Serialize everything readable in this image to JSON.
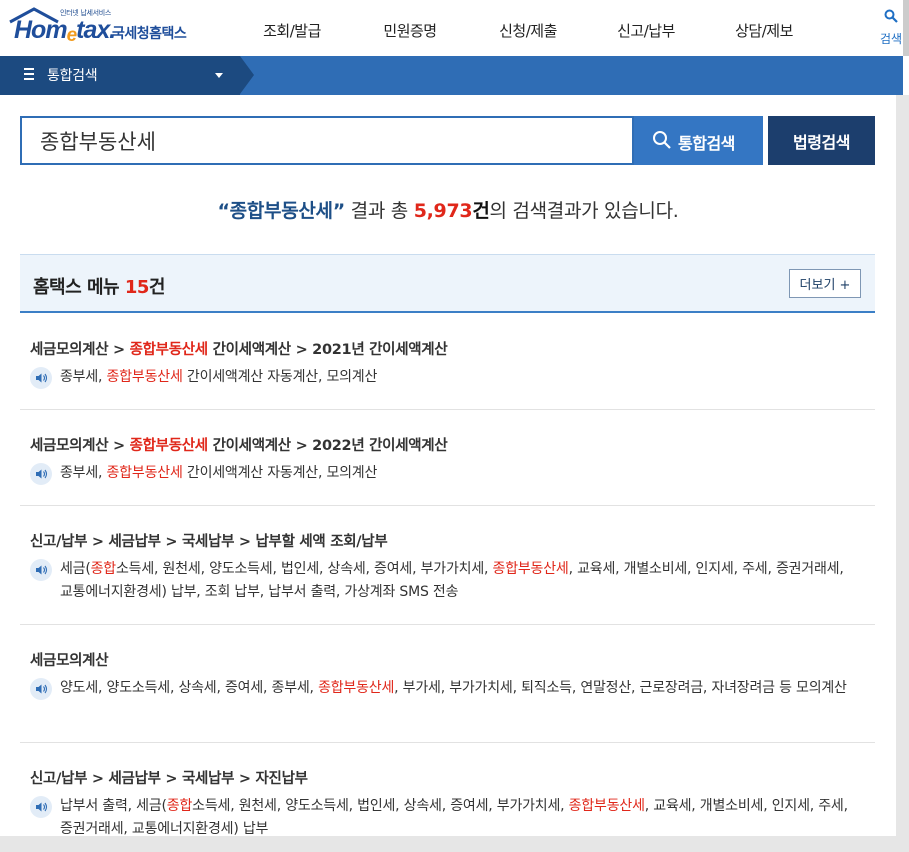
{
  "header": {
    "logo_tagline": "인터넷 납세서비스",
    "logo_home": "Hom",
    "logo_e": "e",
    "logo_tax": "tax.",
    "logo_kr": "국세청홈택스",
    "nav": [
      "조회/발급",
      "민원증명",
      "신청/제출",
      "신고/납부",
      "상담/제보"
    ],
    "search_label": "검색"
  },
  "breadcrumb": {
    "label": "통합검색"
  },
  "search": {
    "value": "종합부동산세",
    "integrated_button": "통합검색",
    "law_button": "법령검색"
  },
  "summary": {
    "quote_open": "“",
    "keyword": "종합부동산세",
    "quote_close": "”",
    "text1": " 결과 총 ",
    "count": "5,973",
    "unit": "건",
    "text2": "의 검색결과가 있습니다."
  },
  "section": {
    "title": "홈택스 메뉴 ",
    "count": "15",
    "unit": "건",
    "more_button": "더보기 +"
  },
  "results": [
    {
      "title_pre": "세금모의계산 > ",
      "title_hl": "종합부동산세",
      "title_post": " 간이세액계산 > 2021년 간이세액계산",
      "desc_pre": "종부세, ",
      "desc_hl": "종합부동산세",
      "desc_post": " 간이세액계산 자동계산, 모의계산"
    },
    {
      "title_pre": "세금모의계산 > ",
      "title_hl": "종합부동산세",
      "title_post": " 간이세액계산 > 2022년 간이세액계산",
      "desc_pre": "종부세, ",
      "desc_hl": "종합부동산세",
      "desc_post": " 간이세액계산 자동계산, 모의계산"
    },
    {
      "title_pre": "신고/납부 > 세금납부 > 국세납부 > 납부할 세액 조회/납부",
      "title_hl": "",
      "title_post": "",
      "desc_a": "세금(",
      "desc_hl1": "종합",
      "desc_b": "소득세, 원천세, 양도소득세, 법인세, 상속세, 증여세, 부가가치세, ",
      "desc_hl2": "종합부동산세",
      "desc_c": ", 교육세, 개별소비세, 인지세, 주세, 증권거래세, 교통에너지환경세) 납부, 조회 납부, 납부서 출력, 가상계좌 SMS 전송"
    },
    {
      "title_pre": "세금모의계산",
      "title_hl": "",
      "title_post": "",
      "desc_pre": "양도세, 양도소득세, 상속세, 증여세, 종부세, ",
      "desc_hl": "종합부동산세",
      "desc_post": ", 부가세, 부가가치세, 퇴직소득, 연말정산, 근로장려금, 자녀장려금 등 모의계산"
    },
    {
      "title_pre": "신고/납부 > 세금납부 > 국세납부 > 자진납부",
      "title_hl": "",
      "title_post": "",
      "desc_a": "납부서 출력, 세금(",
      "desc_hl1": "종합",
      "desc_b": "소득세, 원천세, 양도소득세, 법인세, 상속세, 증여세, 부가가치세, ",
      "desc_hl2": "종합부동산세",
      "desc_c": ", 교육세, 개별소비세, 인지세, 주세, 증권거래세, 교통에너지환경세) 납부"
    }
  ],
  "colors": {
    "brand_blue": "#1f4e9b",
    "bar_blue": "#2f6db5",
    "dark_navy": "#1c3e6d",
    "highlight_red": "#e0271a"
  }
}
